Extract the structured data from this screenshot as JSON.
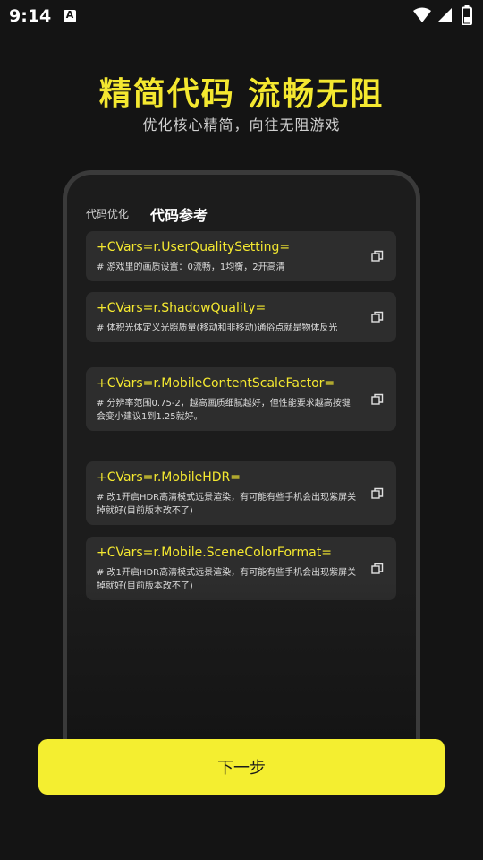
{
  "status_bar": {
    "time": "9:14",
    "notification_icon_letter": "A",
    "icons": [
      "wifi-icon",
      "cell-signal-icon",
      "battery-icon"
    ]
  },
  "header": {
    "title": "精简代码 流畅无阻",
    "subtitle": "优化核心精简，向往无阻游戏"
  },
  "tabs": [
    {
      "label": "代码优化",
      "active": false
    },
    {
      "label": "代码参考",
      "active": true
    }
  ],
  "cards": [
    {
      "title": "+CVars=r.UserQualitySetting=",
      "desc": "# 游戏里的画质设置：0流畅，1均衡，2开高清"
    },
    {
      "title": "+CVars=r.ShadowQuality=",
      "desc": "# 体积光体定义光照质量(移动和非移动)通俗点就是物体反光"
    },
    {
      "title": "+CVars=r.MobileContentScaleFactor=",
      "desc": "# 分辨率范围0.75-2，越高画质细腻越好，但性能要求越高按键会变小建议1到1.25就好。"
    },
    {
      "title": "+CVars=r.MobileHDR=",
      "desc": "# 改1开启HDR高清模式远景渲染，有可能有些手机会出现紫屏关掉就好(目前版本改不了)"
    },
    {
      "title": "+CVars=r.Mobile.SceneColorFormat=",
      "desc": "# 改1开启HDR高清模式远景渲染，有可能有些手机会出现紫屏关掉就好(目前版本改不了)"
    }
  ],
  "next_button": {
    "label": "下一步"
  },
  "colors": {
    "accent": "#f4e830",
    "button": "#f4ee30",
    "background": "#141414",
    "card": "#2d2d2d"
  }
}
